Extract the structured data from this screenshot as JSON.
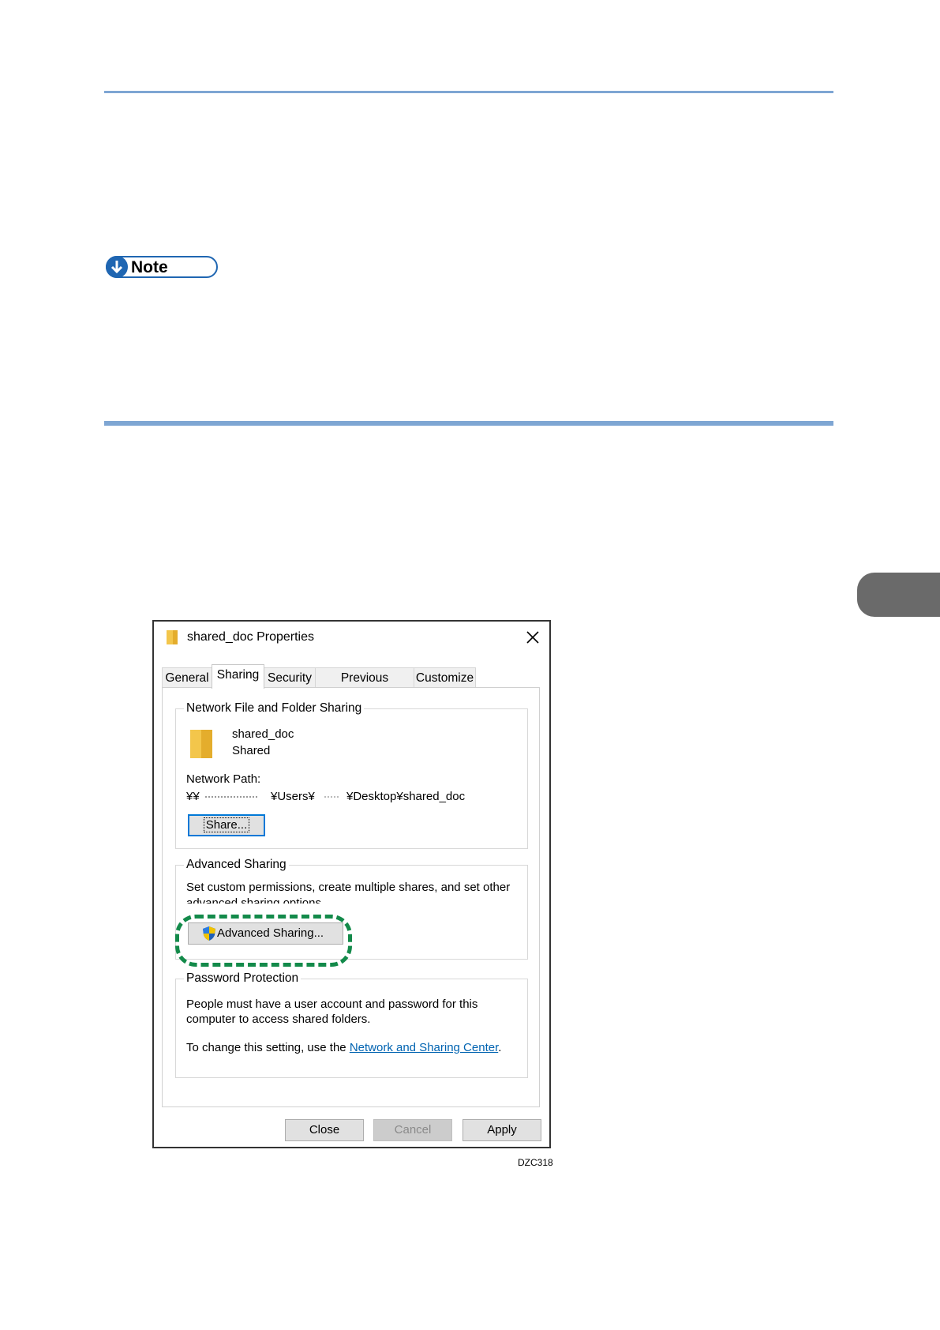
{
  "note": {
    "label": "Note"
  },
  "dialog": {
    "title": "shared_doc Properties",
    "tabs": [
      {
        "label": "General"
      },
      {
        "label": "Sharing"
      },
      {
        "label": "Security"
      },
      {
        "label": "Previous Versions"
      },
      {
        "label": "Customize"
      }
    ],
    "active_tab": "Sharing",
    "network_sharing": {
      "group_title": "Network File and Folder Sharing",
      "folder_name": "shared_doc",
      "folder_status": "Shared",
      "network_path_label": "Network Path:",
      "path_prefix": "¥¥",
      "path_middle": "¥Users¥",
      "path_suffix": "¥Desktop¥shared_doc",
      "share_button": "Share..."
    },
    "advanced_sharing": {
      "group_title": "Advanced Sharing",
      "description_line1": "Set custom permissions, create multiple shares, and set other",
      "description_line2": "advanced sharing options.",
      "button": "Advanced Sharing..."
    },
    "password_protection": {
      "group_title": "Password Protection",
      "line1": "People must have a user account and password for this",
      "line2": "computer to access shared folders.",
      "change_text": "To change this setting, use the ",
      "link_text": "Network and Sharing Center",
      "link_suffix": "."
    },
    "buttons": {
      "close": "Close",
      "cancel": "Cancel",
      "apply": "Apply"
    }
  },
  "figure_code": "DZC318",
  "colors": {
    "accent_rule": "#7ea6d3",
    "note_blue": "#1f66b2",
    "highlight_green": "#138a4a",
    "side_tab": "#6a6a6a"
  }
}
